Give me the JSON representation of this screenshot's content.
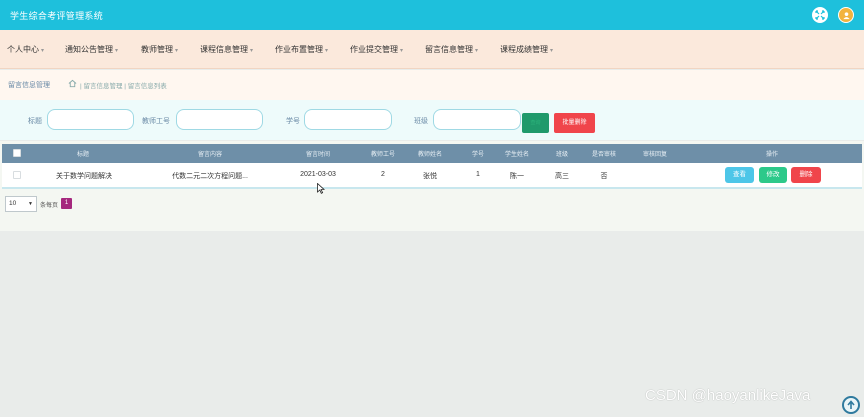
{
  "app": {
    "title": "学生综合考评管理系统"
  },
  "topbar": {
    "fullscreen_icon": "fullscreen-icon",
    "avatar_icon": "user-avatar-icon",
    "accent": "#1ec0dc"
  },
  "nav": {
    "items": [
      {
        "label": "个人中心"
      },
      {
        "label": "通知公告管理"
      },
      {
        "label": "教师管理"
      },
      {
        "label": "课程信息管理"
      },
      {
        "label": "作业布置管理"
      },
      {
        "label": "作业提交管理"
      },
      {
        "label": "留言信息管理"
      },
      {
        "label": "课程成绩管理"
      }
    ]
  },
  "breadcrumb": {
    "current": "留言信息管理",
    "trail": "| 留言信息管理 | 留言信息列表"
  },
  "search": {
    "labels": {
      "title": "标题",
      "teacher_no": "教师工号",
      "student_no": "学号",
      "class": "班级"
    },
    "search_button": "查询",
    "batch_delete_button": "批量删除"
  },
  "table": {
    "headers": [
      "标题",
      "留言内容",
      "留言时间",
      "教师工号",
      "教师姓名",
      "学号",
      "学生姓名",
      "班级",
      "是否审核",
      "审核回复",
      "操作"
    ],
    "rows": [
      {
        "title": "关于数学问题解决",
        "content": "代数二元二次方程问题...",
        "time": "2021-03-03",
        "teacher_no": "2",
        "teacher_name": "张悦",
        "student_no": "1",
        "student_name": "陈一",
        "class": "高三",
        "reviewed": "否",
        "reply": ""
      }
    ],
    "actions": {
      "view": "查看",
      "edit": "修改",
      "delete": "删除"
    }
  },
  "pager": {
    "page_size": "10",
    "label": "条每页",
    "current_page": "1"
  },
  "watermark": "CSDN @haoyanlikeJava"
}
